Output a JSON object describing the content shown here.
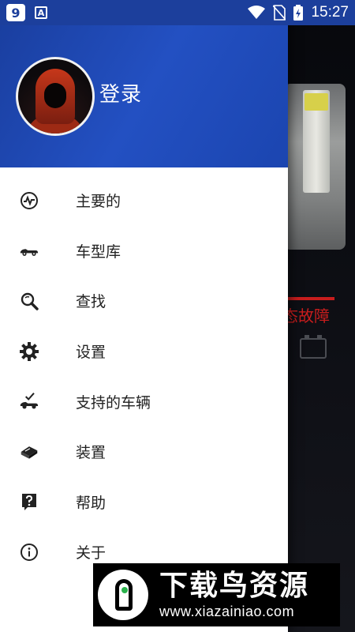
{
  "status_bar": {
    "app_badge": "9",
    "font_badge": "A",
    "time": "15:27"
  },
  "drawer": {
    "header": {
      "login_label": "登录"
    },
    "items": [
      {
        "label": "主要的",
        "icon": "activity-icon"
      },
      {
        "label": "车型库",
        "icon": "car-icon"
      },
      {
        "label": "查找",
        "icon": "search-icon"
      },
      {
        "label": "设置",
        "icon": "gear-icon"
      },
      {
        "label": "支持的车辆",
        "icon": "car-check-icon"
      },
      {
        "label": "装置",
        "icon": "device-icon"
      },
      {
        "label": "帮助",
        "icon": "help-icon"
      },
      {
        "label": "关于",
        "icon": "info-icon"
      }
    ]
  },
  "background": {
    "status_text": "态故障"
  },
  "watermark": {
    "title": "下载鸟资源",
    "url": "www.xiazainiao.com"
  },
  "colors": {
    "header_blue": "#1c3f9c",
    "accent_red": "#c81d1d"
  }
}
